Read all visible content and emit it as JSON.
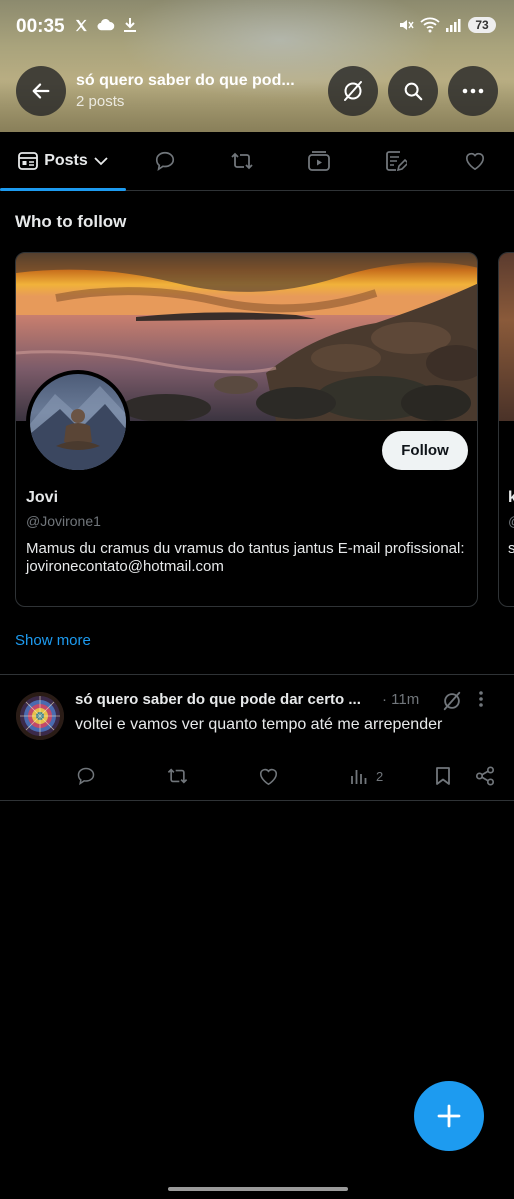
{
  "status_bar": {
    "time": "00:35",
    "left_icons": [
      "x-logo-icon",
      "cloud-icon",
      "download-icon"
    ],
    "right_icons": [
      "mute-icon",
      "wifi-icon",
      "signal-icon"
    ],
    "battery": "73"
  },
  "header": {
    "title": "só quero saber do que pod...",
    "subtitle": "2 posts"
  },
  "tabs": {
    "active_label": "Posts",
    "icons": [
      "replies-icon",
      "reposts-icon",
      "media-icon",
      "articles-icon",
      "likes-icon"
    ]
  },
  "who_to_follow": {
    "title": "Who to follow",
    "card": {
      "name": "Jovi",
      "handle": "@Jovirone1",
      "bio": "Mamus du cramus du vramus do tantus jantus E-mail profissional: jovironecontato@hotmail.com",
      "follow_label": "Follow"
    },
    "peek_card": {
      "name_fragment": "k",
      "handle_fragment": "@",
      "bio_fragment": "s"
    },
    "show_more": "Show more"
  },
  "post": {
    "author": "só quero saber do que pode dar certo ...",
    "time": "· 11m",
    "text": "voltei e vamos ver quanto tempo até me arrepender",
    "views": "2"
  },
  "colors": {
    "accent": "#1d9bf0",
    "background": "#000000",
    "text": "#e7e9ea",
    "muted": "#71767b",
    "border": "#2f3336"
  }
}
